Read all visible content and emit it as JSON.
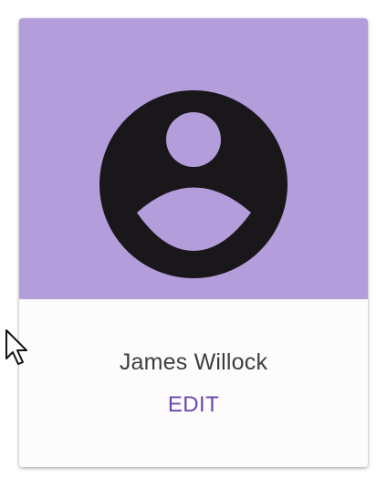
{
  "profile_card": {
    "name": "James Willock",
    "edit_label": "EDIT",
    "avatar_icon": "account-circle-icon",
    "media_color": "#b39ddb",
    "accent_color": "#6a46b0"
  },
  "cursor": {
    "icon": "arrow-cursor-icon"
  }
}
